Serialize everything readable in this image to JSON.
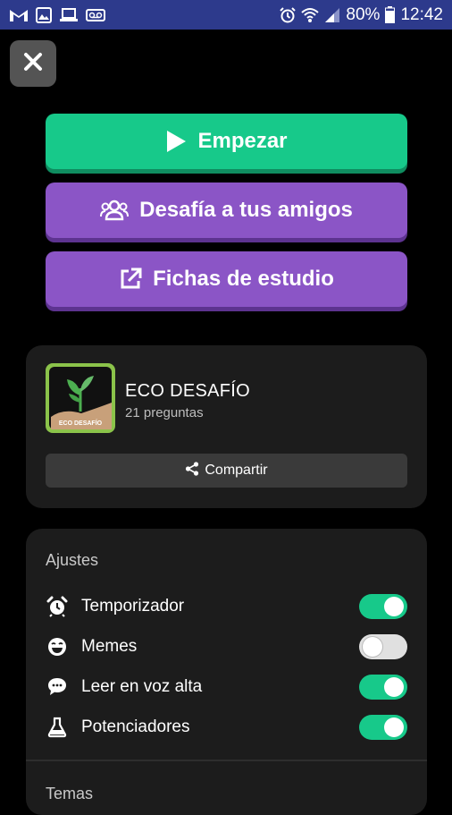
{
  "status_bar": {
    "battery": "80%",
    "time": "12:42",
    "left_icons": [
      "gmail-icon",
      "gallery-icon",
      "laptop-icon",
      "voicemail-icon"
    ],
    "right_icons": [
      "alarm-icon",
      "wifi-icon",
      "signal-icon",
      "battery-icon"
    ]
  },
  "close_button": {
    "icon": "close-icon"
  },
  "actions": {
    "start": {
      "label": "Empezar",
      "icon": "play-icon",
      "color": "#17c98a"
    },
    "challenge": {
      "label": "Desafía a tus amigos",
      "icon": "group-icon",
      "color": "#8b55c6"
    },
    "flashcards": {
      "label": "Fichas de estudio",
      "icon": "external-link-icon",
      "color": "#8b55c6"
    }
  },
  "quiz": {
    "title": "ECO DESAFÍO",
    "subtitle": "21 preguntas",
    "thumbnail_text": "ECO DESAFÍO",
    "share_label": "Compartir"
  },
  "settings": {
    "heading": "Ajustes",
    "items": [
      {
        "label": "Temporizador",
        "icon": "alarm-clock-icon",
        "enabled": true
      },
      {
        "label": "Memes",
        "icon": "laugh-emoji-icon",
        "enabled": false
      },
      {
        "label": "Leer en voz alta",
        "icon": "speech-bubble-icon",
        "enabled": true
      },
      {
        "label": "Potenciadores",
        "icon": "flask-icon",
        "enabled": true
      }
    ]
  },
  "themes": {
    "heading": "Temas"
  },
  "colors": {
    "accent_green": "#17c98a",
    "accent_purple": "#8b55c6",
    "status_bar": "#2d3a8c"
  }
}
